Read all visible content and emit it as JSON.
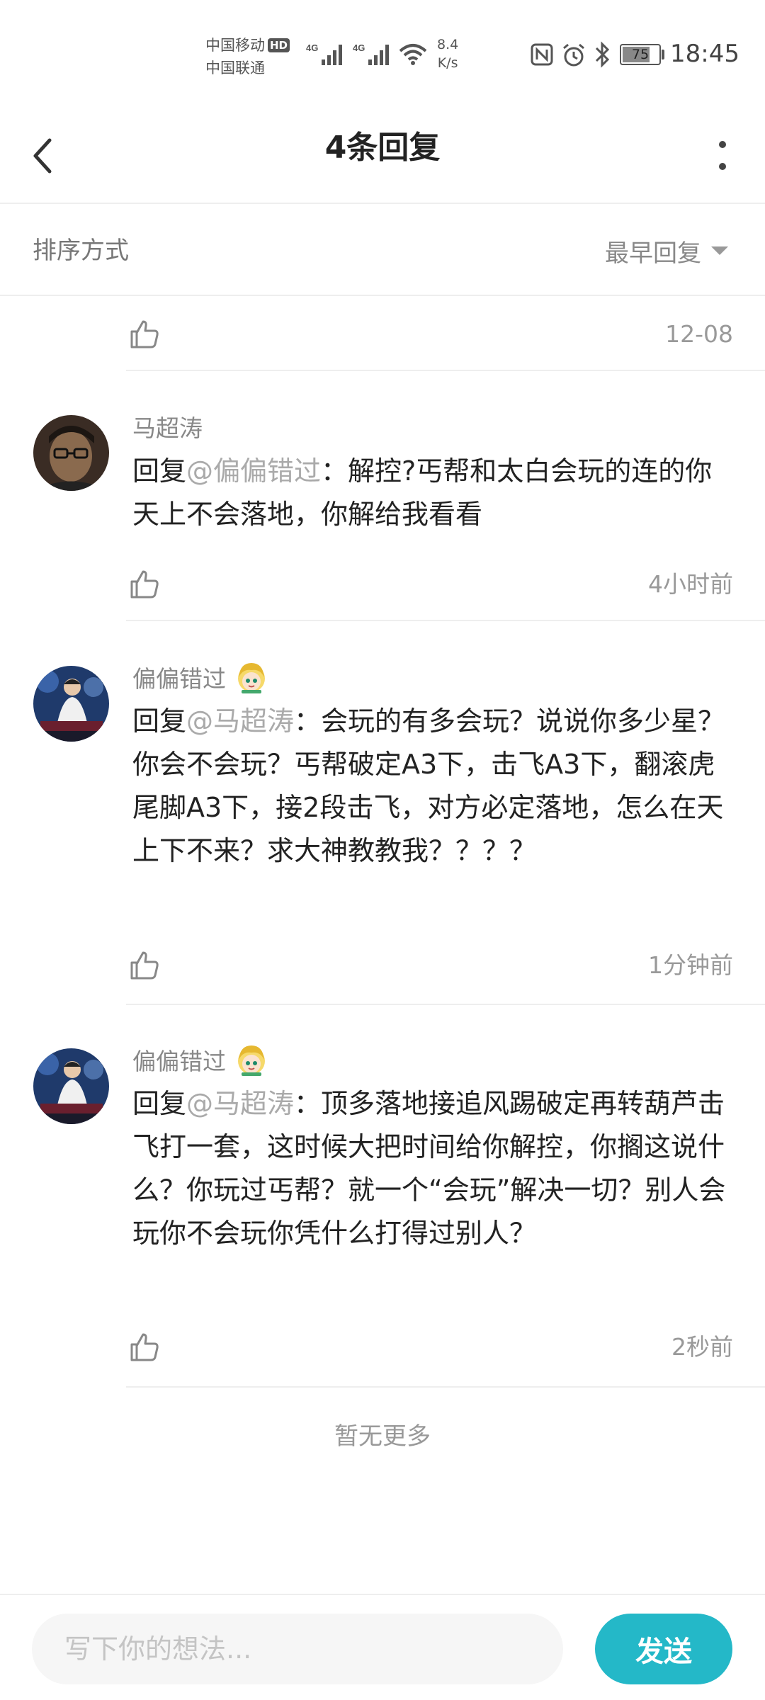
{
  "status_bar": {
    "carrier_1": "中国移动",
    "hd_label": "HD",
    "carrier_2": "中国联通",
    "network_1": "4G",
    "network_2": "4G",
    "speed_value": "8.4",
    "speed_unit": "K/s",
    "battery": "75",
    "time": "18:45"
  },
  "header": {
    "title": "4条回复",
    "back_icon": "chevron-left-icon",
    "more_icon": "more-vertical-icon"
  },
  "sort": {
    "label": "排序方式",
    "value": "最早回复"
  },
  "replies": [
    {
      "time": "12-08"
    },
    {
      "author": "马超涛",
      "prefix": "回复",
      "mention": "@偏偏错过",
      "text": "：解控?丐帮和太白会玩的连的你天上不会落地，你解给我看看",
      "time": "4小时前"
    },
    {
      "author": "偏偏错过",
      "prefix": "回复",
      "mention": "@马超涛",
      "text": "：会玩的有多会玩？说说你多少星？你会不会玩？丐帮破定A3下，击飞A3下，翻滚虎尾脚A3下，接2段击飞，对方必定落地，怎么在天上下不来？求大神教教我？？？？",
      "time": "1分钟前"
    },
    {
      "author": "偏偏错过",
      "prefix": "回复",
      "mention": "@马超涛",
      "text": "：顶多落地接追风踢破定再转葫芦击飞打一套，这时候大把时间给你解控，你搁这说什么？你玩过丐帮？就一个“会玩”解决一切？别人会玩你不会玩你凭什么打得过别人？",
      "time": "2秒前"
    }
  ],
  "footer_note": "暂无更多",
  "composer": {
    "placeholder": "写下你的想法...",
    "value": "",
    "send_label": "发送"
  },
  "colors": {
    "accent": "#24b8c8",
    "mention": "#aaaaaa",
    "muted": "#999999"
  }
}
